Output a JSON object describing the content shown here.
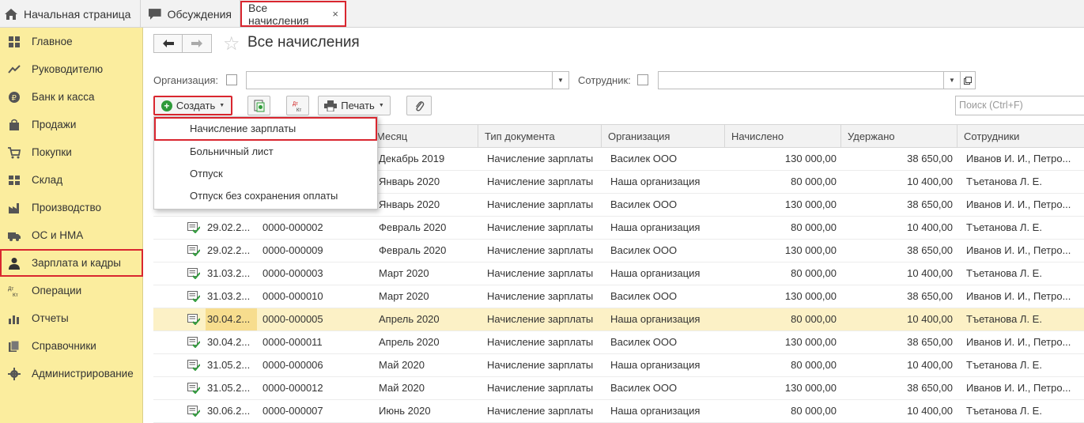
{
  "tabs": {
    "home": "Начальная страница",
    "discussions": "Обсуждения",
    "active": "Все начисления",
    "close": "×"
  },
  "sidebar": {
    "items": [
      {
        "label": "Главное",
        "icon": "menu-icon"
      },
      {
        "label": "Руководителю",
        "icon": "trend-icon"
      },
      {
        "label": "Банк и касса",
        "icon": "ruble-icon"
      },
      {
        "label": "Продажи",
        "icon": "bag-icon"
      },
      {
        "label": "Покупки",
        "icon": "cart-icon"
      },
      {
        "label": "Склад",
        "icon": "warehouse-icon"
      },
      {
        "label": "Производство",
        "icon": "factory-icon"
      },
      {
        "label": "ОС и НМА",
        "icon": "truck-icon"
      },
      {
        "label": "Зарплата и кадры",
        "icon": "person-icon"
      },
      {
        "label": "Операции",
        "icon": "dt-kt-icon"
      },
      {
        "label": "Отчеты",
        "icon": "chart-icon"
      },
      {
        "label": "Справочники",
        "icon": "books-icon"
      },
      {
        "label": "Администрирование",
        "icon": "gear-icon"
      }
    ],
    "selected_index": 8
  },
  "header": {
    "title": "Все начисления"
  },
  "filters": {
    "org_label": "Организация:",
    "employee_label": "Сотрудник:"
  },
  "toolbar": {
    "create_label": "Создать",
    "dtkt_label": "Дт Кт",
    "print_label": "Печать",
    "search_placeholder": "Поиск (Ctrl+F)"
  },
  "dropdown": {
    "items": [
      "Начисление зарплаты",
      "Больничный лист",
      "Отпуск",
      "Отпуск без сохранения оплаты"
    ]
  },
  "table": {
    "columns": [
      "Месяц",
      "Тип документа",
      "Организация",
      "Начислено",
      "Удержано",
      "Сотрудники"
    ],
    "rows": [
      {
        "date": "",
        "number": "",
        "month": "Декабрь 2019",
        "type": "Начисление зарплаты",
        "org": "Василек ООО",
        "accrued": "130 000,00",
        "withheld": "38 650,00",
        "employees": "Иванов И. И., Петро..."
      },
      {
        "date": "",
        "number": "",
        "month": "Январь 2020",
        "type": "Начисление зарплаты",
        "org": "Наша организация",
        "accrued": "80 000,00",
        "withheld": "10 400,00",
        "employees": "Тъетанова Л. Е."
      },
      {
        "date": "",
        "number": "",
        "month": "Январь 2020",
        "type": "Начисление зарплаты",
        "org": "Василек ООО",
        "accrued": "130 000,00",
        "withheld": "38 650,00",
        "employees": "Иванов И. И., Петро..."
      },
      {
        "date": "29.02.2...",
        "number": "0000-000002",
        "month": "Февраль 2020",
        "type": "Начисление зарплаты",
        "org": "Наша организация",
        "accrued": "80 000,00",
        "withheld": "10 400,00",
        "employees": "Тъетанова Л. Е."
      },
      {
        "date": "29.02.2...",
        "number": "0000-000009",
        "month": "Февраль 2020",
        "type": "Начисление зарплаты",
        "org": "Василек ООО",
        "accrued": "130 000,00",
        "withheld": "38 650,00",
        "employees": "Иванов И. И., Петро..."
      },
      {
        "date": "31.03.2...",
        "number": "0000-000003",
        "month": "Март 2020",
        "type": "Начисление зарплаты",
        "org": "Наша организация",
        "accrued": "80 000,00",
        "withheld": "10 400,00",
        "employees": "Тъетанова Л. Е."
      },
      {
        "date": "31.03.2...",
        "number": "0000-000010",
        "month": "Март 2020",
        "type": "Начисление зарплаты",
        "org": "Василек ООО",
        "accrued": "130 000,00",
        "withheld": "38 650,00",
        "employees": "Иванов И. И., Петро..."
      },
      {
        "date": "30.04.2...",
        "number": "0000-000005",
        "month": "Апрель 2020",
        "type": "Начисление зарплаты",
        "org": "Наша организация",
        "accrued": "80 000,00",
        "withheld": "10 400,00",
        "employees": "Тъетанова Л. Е."
      },
      {
        "date": "30.04.2...",
        "number": "0000-000011",
        "month": "Апрель 2020",
        "type": "Начисление зарплаты",
        "org": "Василек ООО",
        "accrued": "130 000,00",
        "withheld": "38 650,00",
        "employees": "Иванов И. И., Петро..."
      },
      {
        "date": "31.05.2...",
        "number": "0000-000006",
        "month": "Май 2020",
        "type": "Начисление зарплаты",
        "org": "Наша организация",
        "accrued": "80 000,00",
        "withheld": "10 400,00",
        "employees": "Тъетанова Л. Е."
      },
      {
        "date": "31.05.2...",
        "number": "0000-000012",
        "month": "Май 2020",
        "type": "Начисление зарплаты",
        "org": "Василек ООО",
        "accrued": "130 000,00",
        "withheld": "38 650,00",
        "employees": "Иванов И. И., Петро..."
      },
      {
        "date": "30.06.2...",
        "number": "0000-000007",
        "month": "Июнь 2020",
        "type": "Начисление зарплаты",
        "org": "Наша организация",
        "accrued": "80 000,00",
        "withheld": "10 400,00",
        "employees": "Тъетанова Л. Е."
      }
    ],
    "highlighted_index": 7
  },
  "colors": {
    "sidebar_bg": "#fbed9e",
    "highlight_red": "#d9262f",
    "row_highlight": "#fcf1c6",
    "create_plus": "#2e9a3a"
  }
}
